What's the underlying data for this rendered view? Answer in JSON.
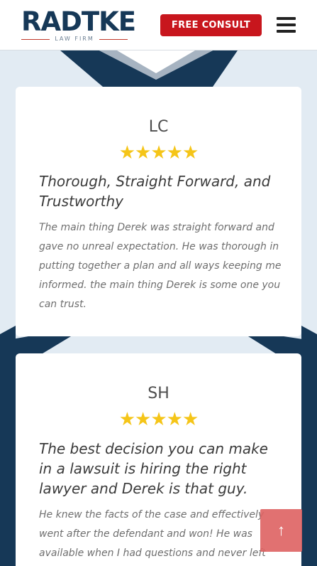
{
  "header": {
    "logo_word": "RADTKE",
    "logo_sub": "LAW FIRM",
    "consult_label": "FREE CONSULT"
  },
  "reviews": [
    {
      "initials": "LC",
      "stars": "★★★★★",
      "rating": 5,
      "title": "Thorough, Straight Forward, and Trustworthy",
      "body": "The main thing Derek was straight forward and gave no unreal expectation. He was thorough in putting together a plan and all ways keeping me informed. the main thing Derek is some one you can trust."
    },
    {
      "initials": "SH",
      "stars": "★★★★★",
      "rating": 5,
      "title": "The best decision you can make in a lawsuit is hiring the right lawyer and Derek is that guy.",
      "body": "He knew the facts of the case and effectively went after the defendant and won! He was available when I had questions and never left"
    }
  ],
  "scroll_top_glyph": "↑",
  "colors": {
    "navy": "#163857",
    "red": "#c8161d",
    "star": "#f5c518",
    "bg": "#e2ebf3"
  }
}
